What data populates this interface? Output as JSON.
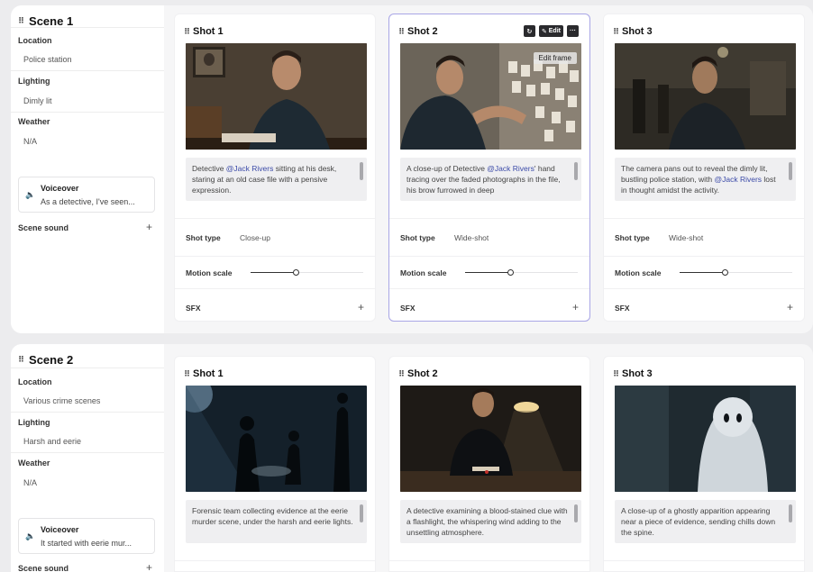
{
  "scenes": [
    {
      "title": "Scene 1",
      "location_label": "Location",
      "location": "Police station",
      "lighting_label": "Lighting",
      "lighting": "Dimly lit",
      "weather_label": "Weather",
      "weather": "N/A",
      "voiceover_label": "Voiceover",
      "voiceover_text": "As a detective, I've seen...",
      "scene_sound_label": "Scene sound",
      "shots": [
        {
          "title": "Shot 1",
          "desc_before": "Detective ",
          "mention": "@Jack Rivers",
          "desc_after": " sitting at his desk, staring at an old case file with a pensive expression.",
          "shot_type_label": "Shot type",
          "shot_type": "Close-up",
          "motion_label": "Motion scale",
          "motion_value": 0.4,
          "sfx_label": "SFX"
        },
        {
          "title": "Shot 2",
          "desc_before": "A close-up of Detective ",
          "mention": "@Jack Rivers",
          "desc_after": "' hand tracing over the faded photographs in the file, his brow furrowed in deep",
          "shot_type_label": "Shot type",
          "shot_type": "Wide-shot",
          "motion_label": "Motion scale",
          "motion_value": 0.4,
          "sfx_label": "SFX",
          "toolbar": {
            "edit_label": "Edit",
            "more_label": "···",
            "tooltip": "Edit frame"
          }
        },
        {
          "title": "Shot 3",
          "desc_before": "The camera pans out to reveal the dimly lit, bustling police station, with ",
          "mention": "@Jack Rivers",
          "desc_after": " lost in thought amidst the activity.",
          "shot_type_label": "Shot type",
          "shot_type": "Wide-shot",
          "motion_label": "Motion scale",
          "motion_value": 0.4,
          "sfx_label": "SFX"
        }
      ]
    },
    {
      "title": "Scene 2",
      "location_label": "Location",
      "location": "Various crime scenes",
      "lighting_label": "Lighting",
      "lighting": "Harsh and eerie",
      "weather_label": "Weather",
      "weather": "N/A",
      "voiceover_label": "Voiceover",
      "voiceover_text": "It started with eerie mur...",
      "scene_sound_label": "Scene sound",
      "shots": [
        {
          "title": "Shot 1",
          "desc": "Forensic team collecting evidence at the eerie murder scene, under the harsh and eerie lights."
        },
        {
          "title": "Shot 2",
          "desc": "A detective examining a blood-stained clue with a flashlight, the whispering wind adding to the unsettling atmosphere."
        },
        {
          "title": "Shot 3",
          "desc": "A close-up of a ghostly apparition appearing near a piece of evidence, sending chills down the spine."
        }
      ]
    }
  ],
  "icons": {
    "grip": "grip-dots-icon",
    "plus": "plus-icon",
    "speaker": "speaker-icon",
    "refresh": "refresh-icon",
    "edit": "edit-icon",
    "more": "more-icon"
  },
  "colors": {
    "selected_border": "#a9a6e6",
    "mention": "#3b4aa8",
    "toolbar_bg": "#2a2a2d"
  }
}
